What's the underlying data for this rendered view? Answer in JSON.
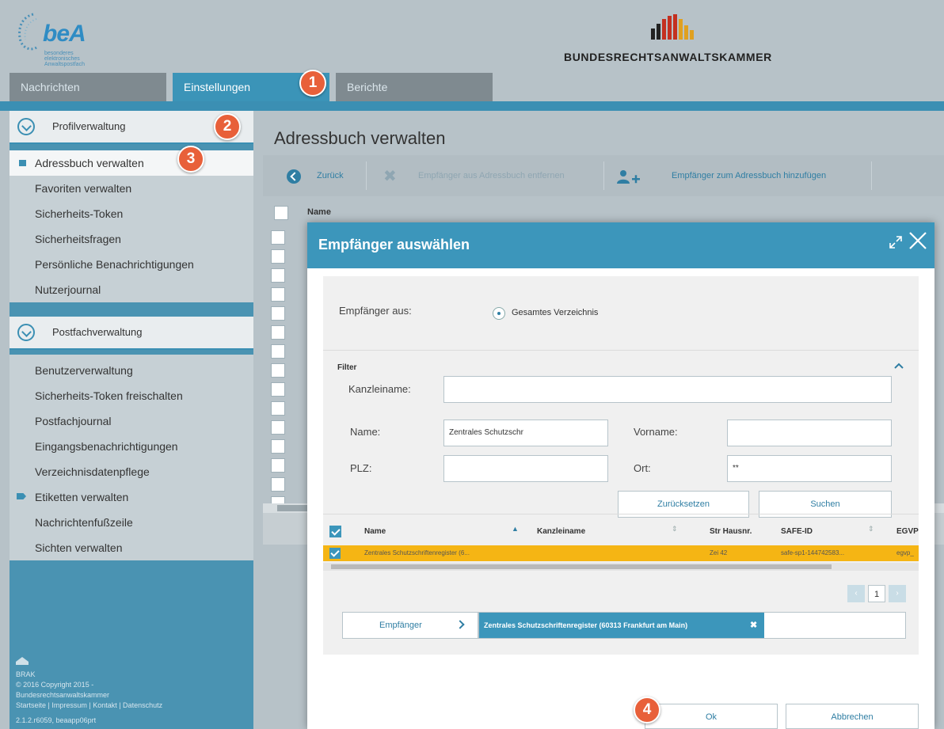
{
  "brand": {
    "logo_text": "beA",
    "logo_tagline": "besonderes elektronisches Anwaltspostfach",
    "org_name": "BUNDESRECHTSANWALTSKAMMER",
    "colors": {
      "accent": "#3c96bb",
      "highlight": "#f5b514",
      "badge": "#e8603a"
    }
  },
  "tabs": [
    {
      "label": "Nachrichten"
    },
    {
      "label": "Einstellungen"
    },
    {
      "label": "Berichte"
    }
  ],
  "sidebar": {
    "profile": {
      "header": "Profilverwaltung",
      "items": [
        {
          "label": "Adressbuch verwalten"
        },
        {
          "label": "Favoriten verwalten"
        },
        {
          "label": "Sicherheits-Token"
        },
        {
          "label": "Sicherheitsfragen"
        },
        {
          "label": "Persönliche Benachrichtigungen"
        },
        {
          "label": "Nutzerjournal"
        }
      ]
    },
    "mailbox": {
      "header": "Postfachverwaltung",
      "items": [
        {
          "label": "Benutzerverwaltung"
        },
        {
          "label": "Sicherheits-Token freischalten"
        },
        {
          "label": "Postfachjournal"
        },
        {
          "label": "Eingangsbenachrichtigungen"
        },
        {
          "label": "Verzeichnisdatenpflege"
        },
        {
          "label": "Etiketten verwalten"
        },
        {
          "label": "Nachrichtenfußzeile"
        },
        {
          "label": "Sichten verwalten"
        }
      ]
    },
    "footer": {
      "icon_label": "BRAK",
      "copyright": "© 2016 Copyright 2015 -",
      "org": "Bundesrechtsanwaltskammer",
      "links": "Startseite | Impressum | Kontakt | Datenschutz",
      "version": "2.1.2.r6059, beaapp06prt"
    }
  },
  "main": {
    "title": "Adressbuch verwalten",
    "toolbar": {
      "back": "Zurück",
      "remove": "Empfänger aus Adressbuch entfernen",
      "add": "Empfänger zum Adressbuch hinzufügen"
    },
    "list_header": "Name"
  },
  "modal": {
    "title": "Empfänger auswählen",
    "source_label": "Empfänger aus:",
    "source_option": "Gesamtes Verzeichnis",
    "filter": {
      "title": "Filter",
      "kanzlei_label": "Kanzleiname:",
      "kanzlei_value": "",
      "name_label": "Name:",
      "name_value": "Zentrales Schutzschr",
      "vorname_label": "Vorname:",
      "vorname_value": "",
      "plz_label": "PLZ:",
      "plz_value": "",
      "ort_label": "Ort:",
      "ort_value": "**",
      "reset": "Zurücksetzen",
      "search": "Suchen"
    },
    "grid": {
      "columns": [
        "Name",
        "Kanzleiname",
        "Str Hausnr.",
        "SAFE-ID",
        "EGVP"
      ],
      "rows": [
        {
          "name": "Zentrales Schutzschriftenregister (6...",
          "kanzlei": "",
          "street": "Zei 42",
          "safe_id": "safe-sp1-144742583...",
          "egvp": "egvp_"
        }
      ],
      "page": "1"
    },
    "recipient_button": "Empfänger",
    "recipient_chip": "Zentrales Schutzschriftenregister (60313 Frankfurt am Main)",
    "ok": "Ok",
    "cancel": "Abbrechen"
  },
  "badges": [
    "1",
    "2",
    "3",
    "4"
  ]
}
